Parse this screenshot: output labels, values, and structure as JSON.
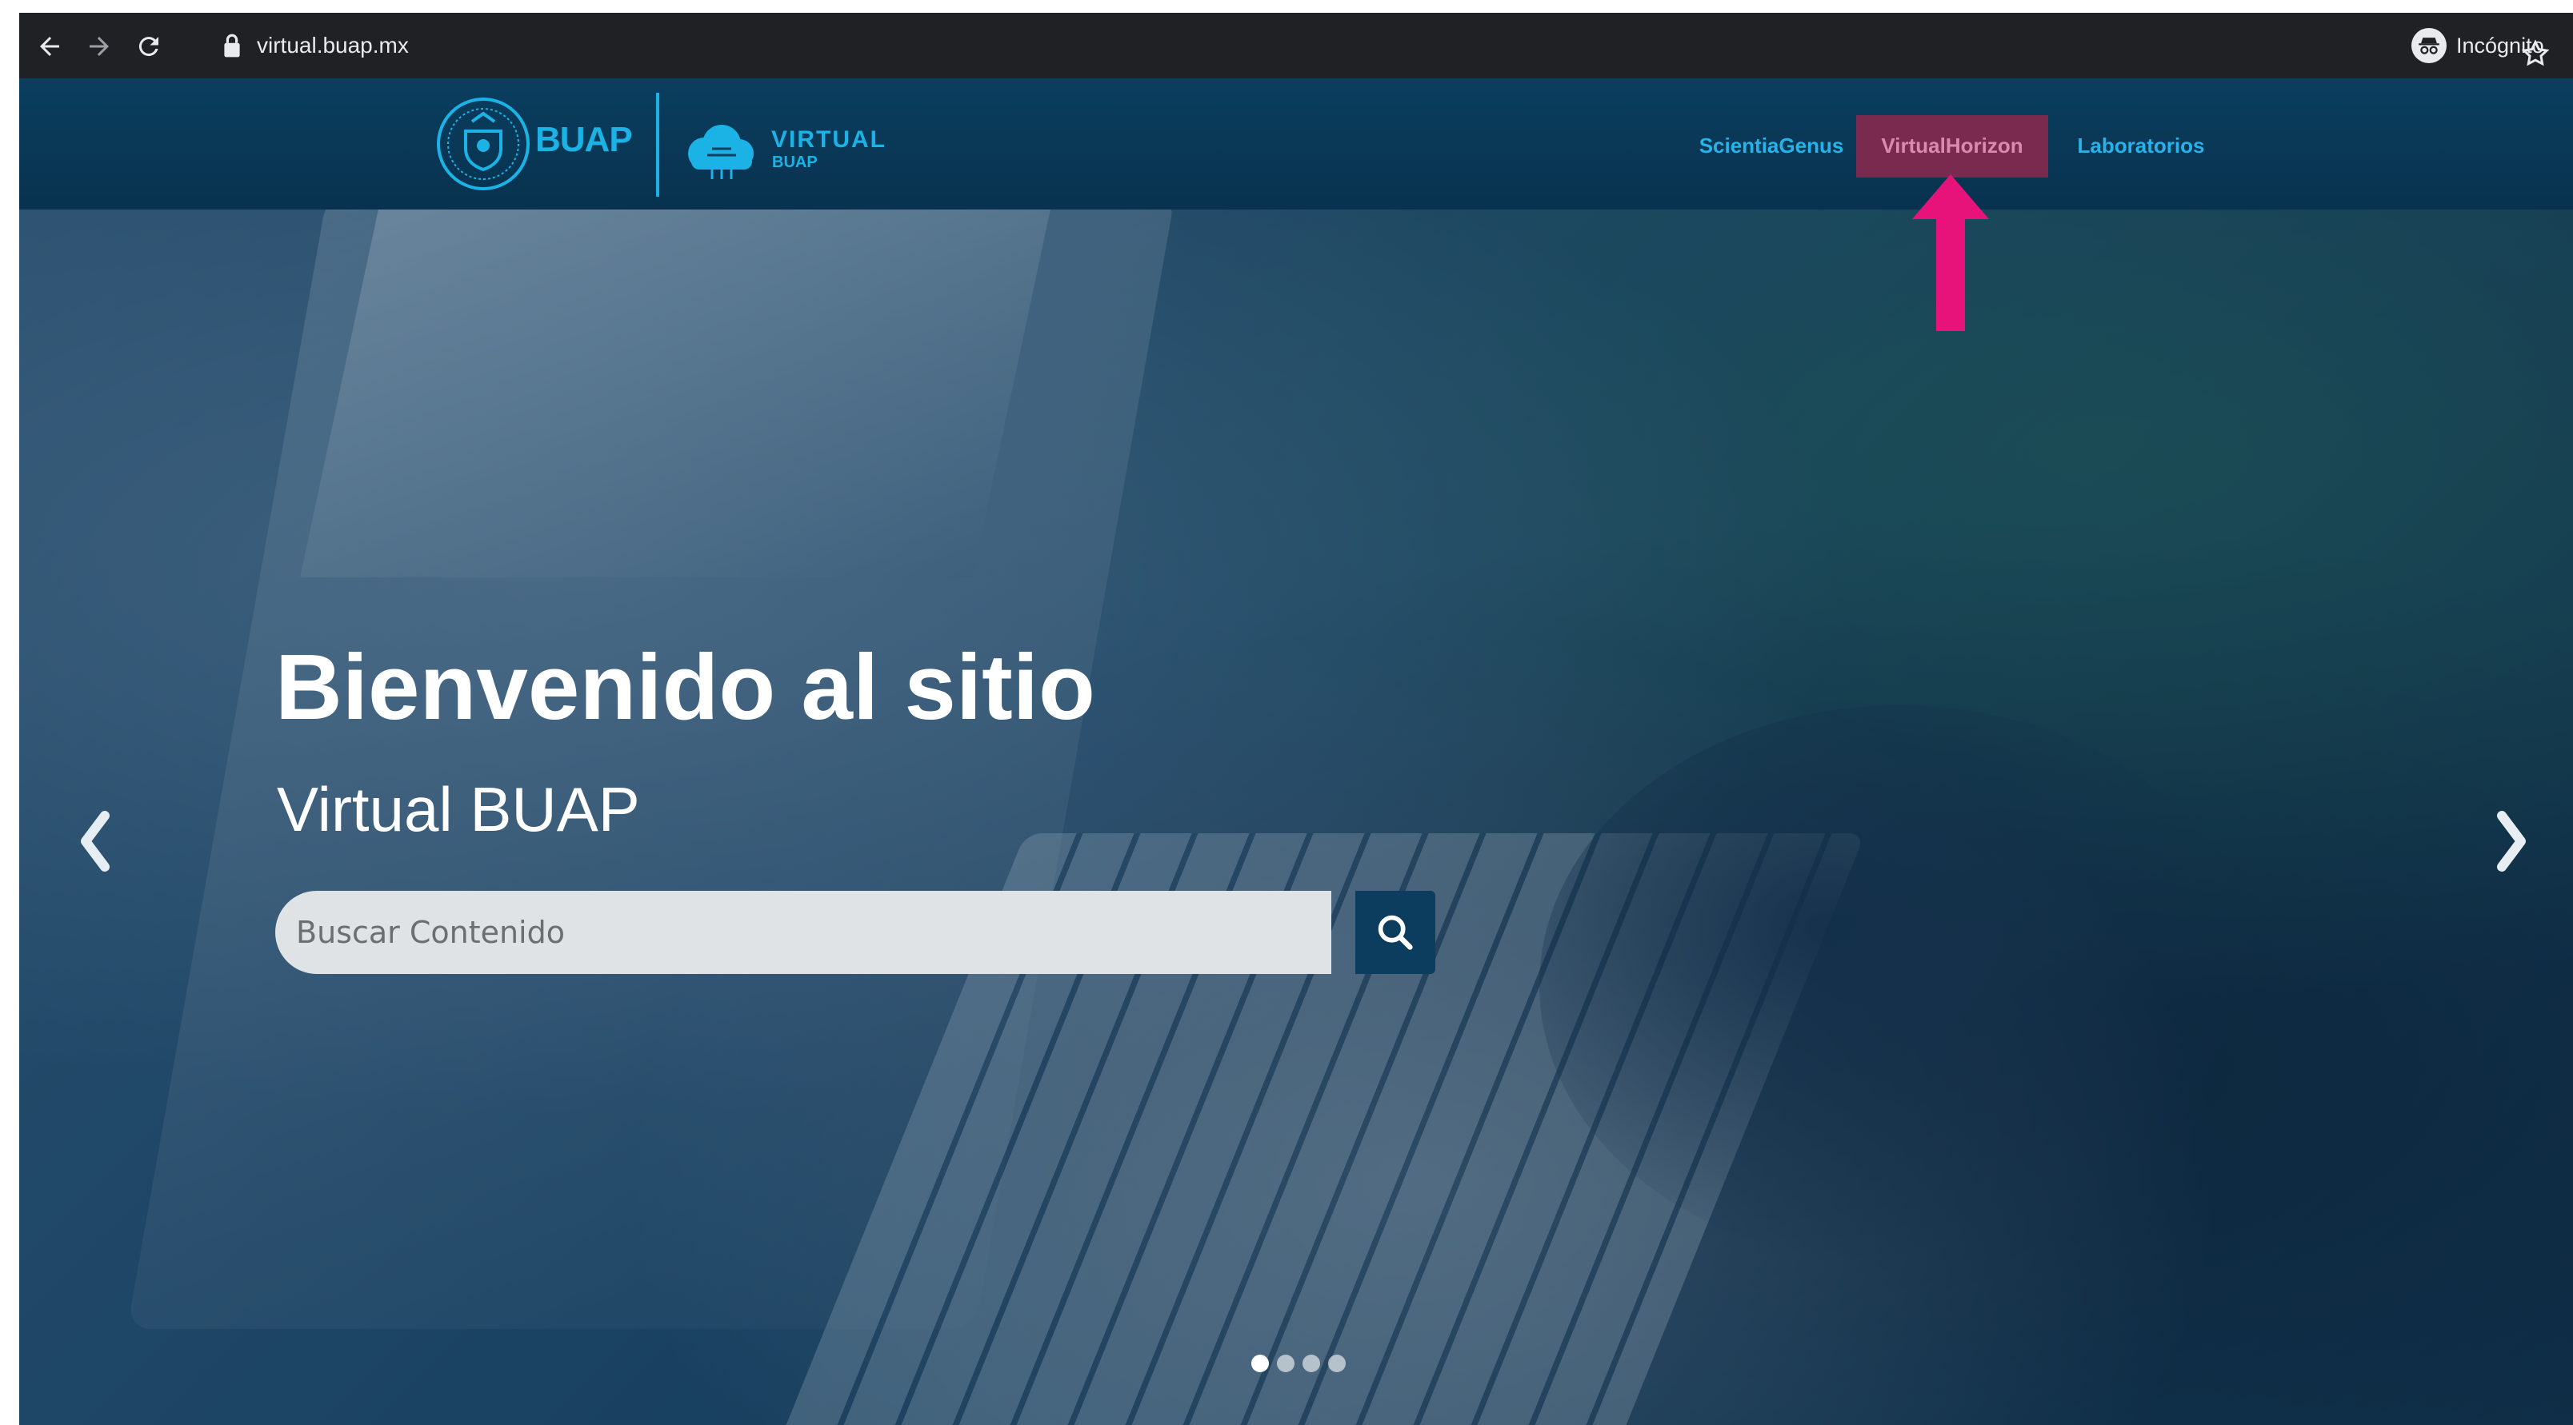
{
  "browser": {
    "url": "virtual.buap.mx",
    "incognito_label": "Incógnito"
  },
  "header": {
    "logo_text": "BUAP",
    "logo_virtual_text": "VIRTUAL",
    "logo_virtual_sub": "BUAP",
    "nav": [
      {
        "label": "ScientiaGenus"
      },
      {
        "label": "VirtualHorizon",
        "highlighted": true
      },
      {
        "label": "Laboratorios"
      }
    ]
  },
  "hero": {
    "title": "Bienvenido al sitio",
    "subtitle": "Virtual BUAP",
    "search": {
      "placeholder": "Buscar Contenido",
      "value": ""
    },
    "carousel": {
      "slide_count": 4,
      "active_index": 0
    }
  },
  "colors": {
    "header_bg": "#0b3e5f",
    "nav_link": "#27b3ea",
    "nav_active_bg": "#7a2a4e",
    "annotation_arrow": "#e8137a"
  },
  "icons": {
    "back": "back-arrow-icon",
    "forward": "forward-arrow-icon",
    "reload": "reload-icon",
    "lock": "lock-icon",
    "bookmark": "star-icon",
    "incognito": "incognito-icon",
    "search": "search-icon",
    "carousel_prev": "chevron-left-icon",
    "carousel_next": "chevron-right-icon",
    "annotation": "arrow-up-icon"
  }
}
